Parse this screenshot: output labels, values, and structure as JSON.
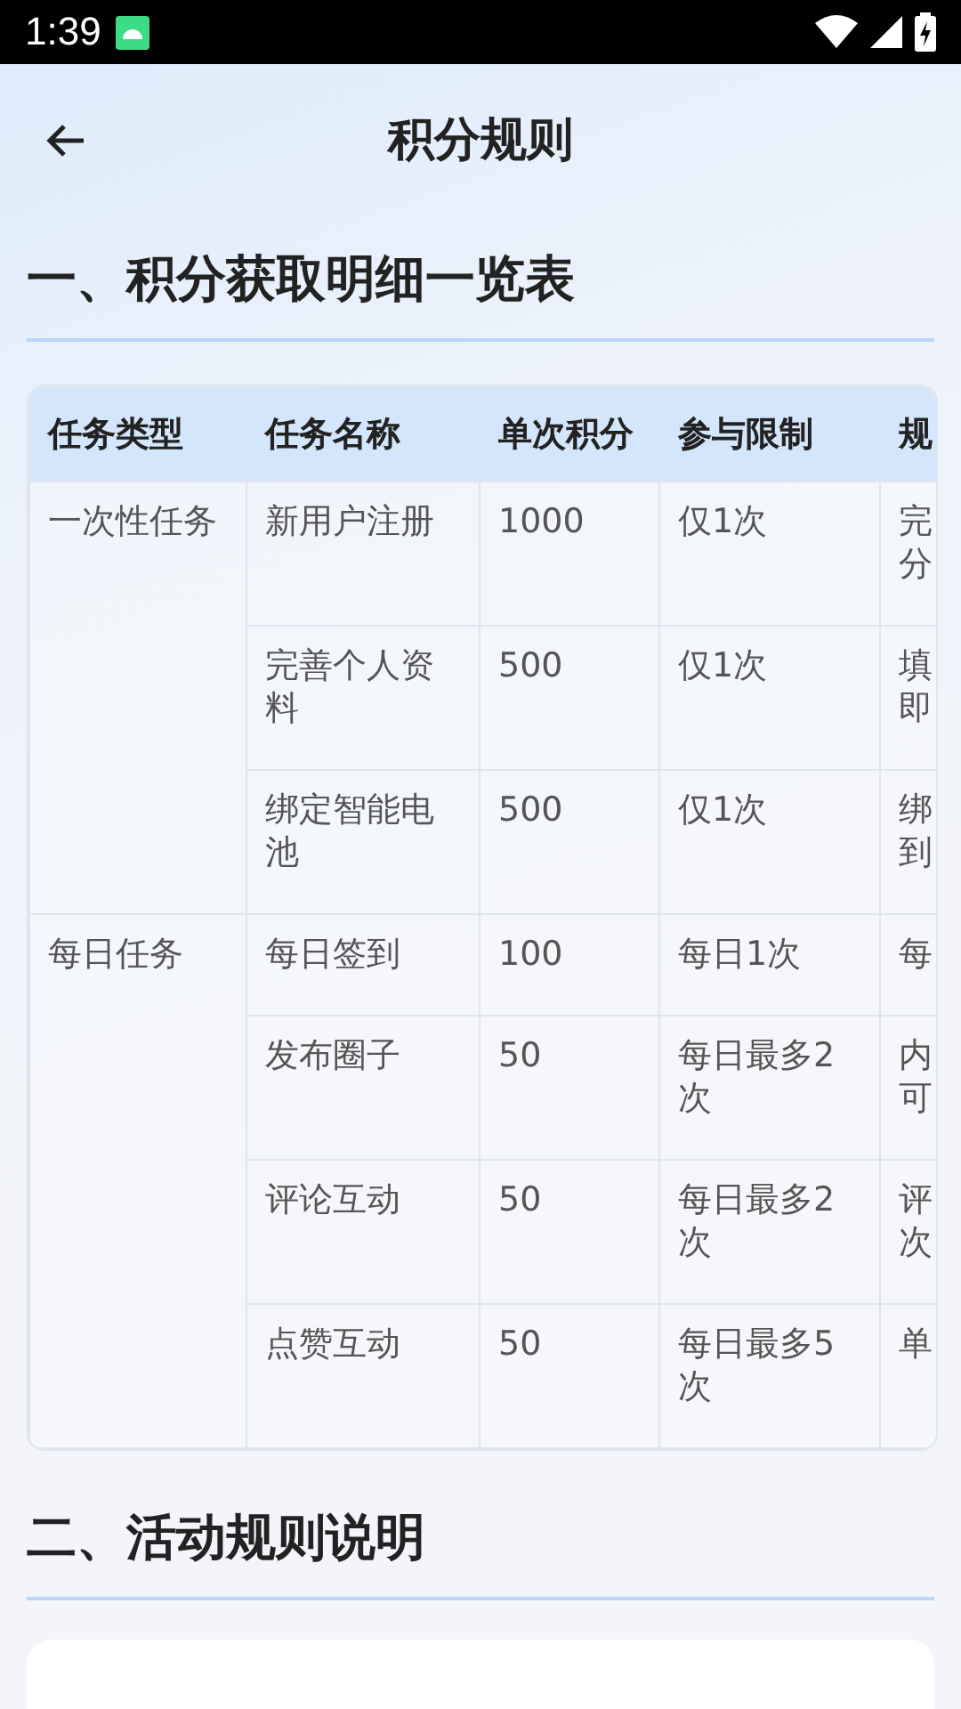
{
  "status_bar": {
    "time": "1:39"
  },
  "header": {
    "title": "积分规则"
  },
  "sections": [
    {
      "heading": "一、积分获取明细一览表",
      "table": {
        "columns": [
          "任务类型",
          "任务名称",
          "单次积分",
          "参与限制",
          "规"
        ],
        "groups": [
          {
            "type": "一次性任务",
            "rows": [
              [
                "新用户注册",
                "1000",
                "仅1次",
                "完分"
              ],
              [
                "完善个人资料",
                "500",
                "仅1次",
                "填即"
              ],
              [
                "绑定智能电池",
                "500",
                "仅1次",
                "绑到"
              ]
            ]
          },
          {
            "type": "每日任务",
            "rows": [
              [
                "每日签到",
                "100",
                "每日1次",
                "每"
              ],
              [
                "发布圈子",
                "50",
                "每日最多2次",
                "内可"
              ],
              [
                "评论互动",
                "50",
                "每日最多2次",
                "评次"
              ],
              [
                "点赞互动",
                "50",
                "每日最多5次",
                "单"
              ]
            ]
          }
        ]
      }
    },
    {
      "heading": "二、活动规则说明",
      "card": true
    }
  ]
}
